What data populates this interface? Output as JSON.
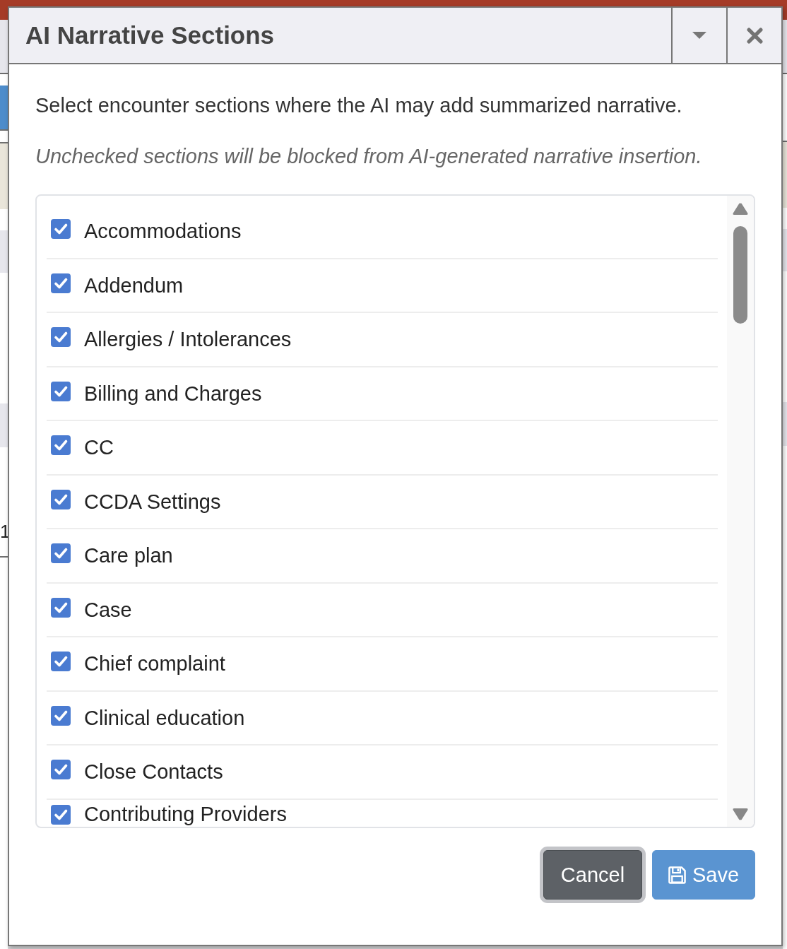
{
  "background": {
    "row_text": "1"
  },
  "dialog": {
    "title": "AI Narrative Sections",
    "intro": "Select encounter sections where the AI may add summarized narrative.",
    "note": "Unchecked sections will be blocked from AI-generated narrative insertion."
  },
  "sections": [
    {
      "label": "Accommodations",
      "checked": true
    },
    {
      "label": "Addendum",
      "checked": true
    },
    {
      "label": "Allergies / Intolerances",
      "checked": true
    },
    {
      "label": "Billing and Charges",
      "checked": true
    },
    {
      "label": "CC",
      "checked": true
    },
    {
      "label": "CCDA Settings",
      "checked": true
    },
    {
      "label": "Care plan",
      "checked": true
    },
    {
      "label": "Case",
      "checked": true
    },
    {
      "label": "Chief complaint",
      "checked": true
    },
    {
      "label": "Clinical education",
      "checked": true
    },
    {
      "label": "Close Contacts",
      "checked": true
    },
    {
      "label": "Contributing Providers",
      "checked": true
    }
  ],
  "buttons": [
    {
      "label": "Cancel",
      "kind": "secondary",
      "focused": true
    },
    {
      "label": "Save",
      "kind": "primary",
      "focused": false
    }
  ]
}
